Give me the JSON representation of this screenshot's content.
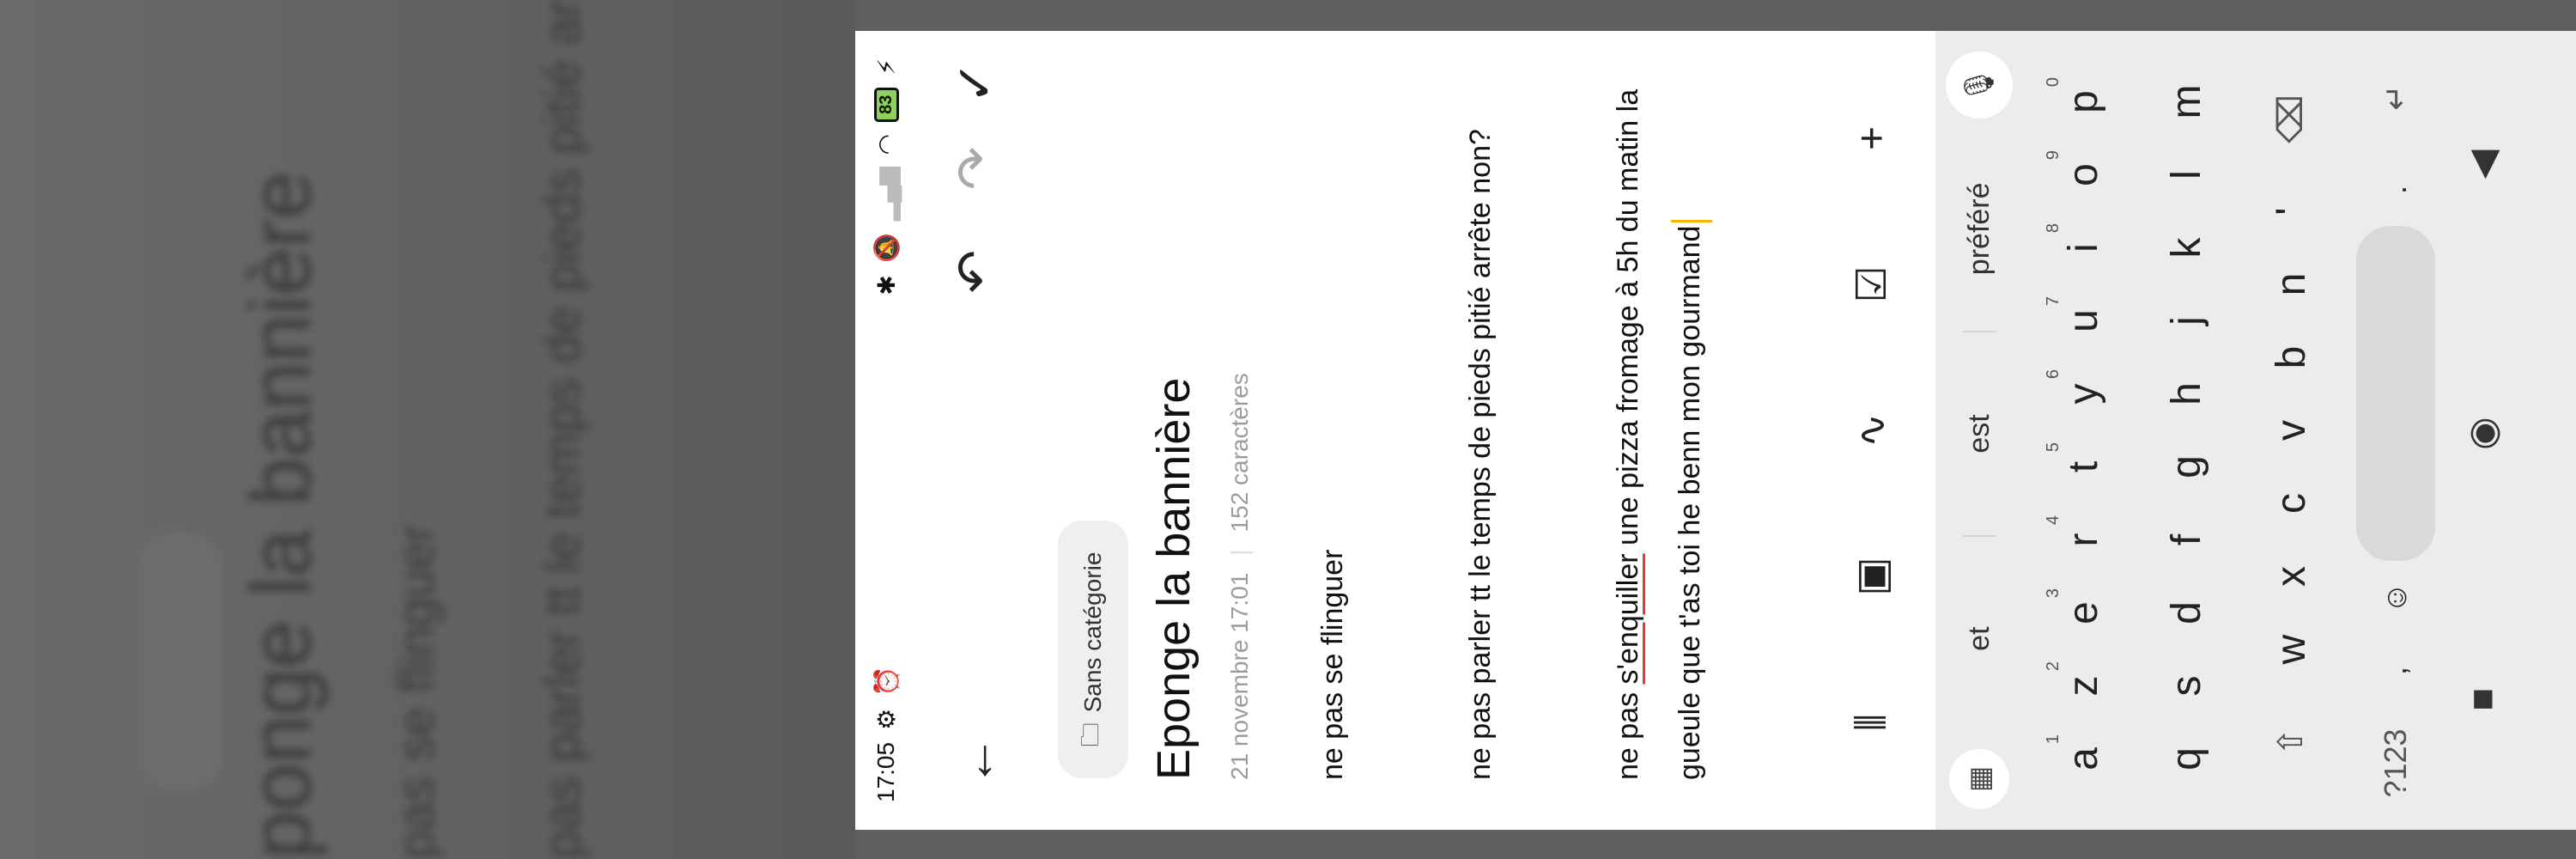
{
  "status_bar": {
    "time": "17:05",
    "battery_level": "83"
  },
  "toolbar": {
    "back_icon": "arrow-back-icon",
    "undo_icon": "undo-icon",
    "redo_icon": "redo-icon",
    "done_icon": "checkmark-icon"
  },
  "note": {
    "category": "Sans catégorie",
    "title": "Eponge la bannière",
    "date": "21 novembre  17:01",
    "char_count": "152 caractères",
    "paragraph_1": "ne pas se flinguer",
    "paragraph_2": "ne pas parler tt le temps de pieds pitié arrête non?",
    "paragraph_3_start": "ne pas ",
    "paragraph_3_misspelled": "s'enquiller",
    "paragraph_3_end": " une pizza fromage à 5h du matin la gueule que t'as toi he benn mon gourmand"
  },
  "edit_tools": {
    "voice_icon": "waveform-icon",
    "image_icon": "image-icon",
    "draw_icon": "scribble-icon",
    "checkbox_icon": "checkbox-icon",
    "add_icon": "plus-icon"
  },
  "keyboard": {
    "suggestions": [
      "et",
      "est",
      "préféré"
    ],
    "row1": [
      {
        "k": "a",
        "h": "1"
      },
      {
        "k": "z",
        "h": "2"
      },
      {
        "k": "e",
        "h": "3"
      },
      {
        "k": "r",
        "h": "4"
      },
      {
        "k": "t",
        "h": "5"
      },
      {
        "k": "y",
        "h": "6"
      },
      {
        "k": "u",
        "h": "7"
      },
      {
        "k": "i",
        "h": "8"
      },
      {
        "k": "o",
        "h": "9"
      },
      {
        "k": "p",
        "h": "0"
      }
    ],
    "row2": [
      "q",
      "s",
      "d",
      "f",
      "g",
      "h",
      "j",
      "k",
      "l",
      "m"
    ],
    "row3": [
      "w",
      "x",
      "c",
      "v",
      "b",
      "n",
      "'"
    ],
    "row4": {
      "sym": "?123",
      "comma": ",",
      "period": "."
    }
  },
  "background": {
    "ghost_title": "ponge la bannière",
    "ghost_line1": "pas se flinguer",
    "ghost_line2": "pas parler tt le temps de pieds pitié arrê"
  }
}
